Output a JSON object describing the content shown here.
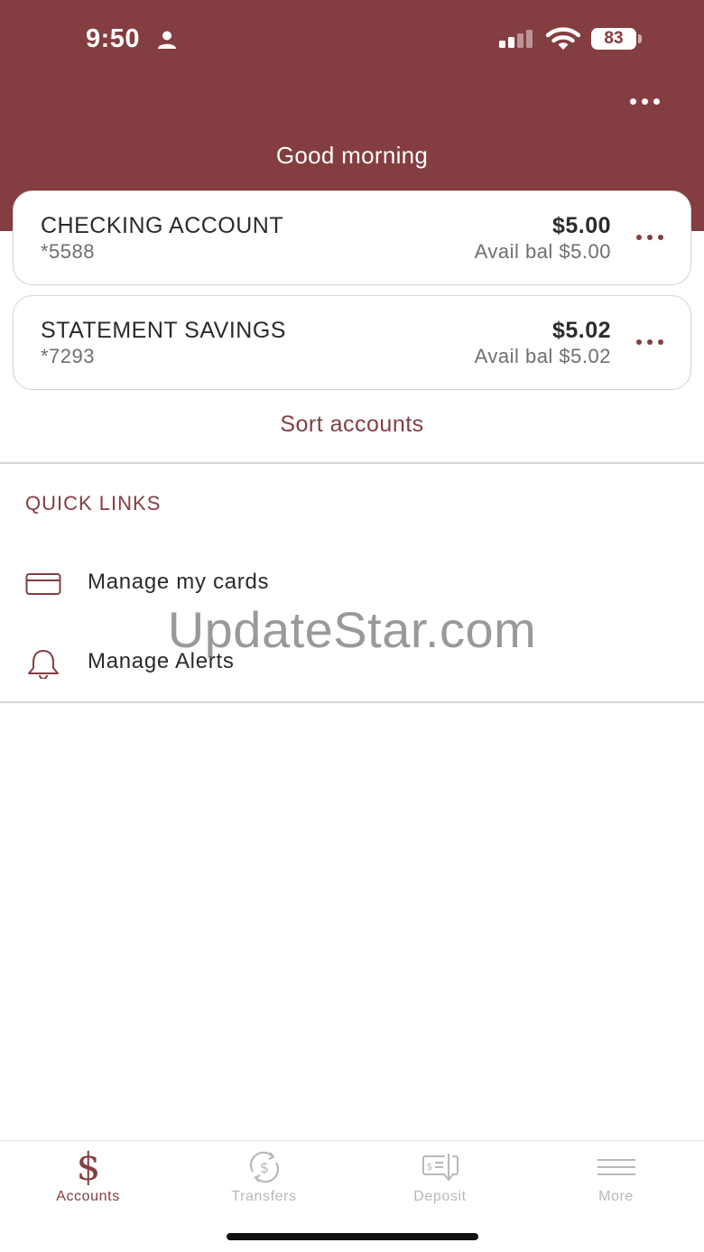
{
  "status_bar": {
    "time": "9:50",
    "battery": "83"
  },
  "header": {
    "greeting": "Good morning",
    "more_icon": "more-horizontal-icon",
    "color": "#843d40"
  },
  "accounts": [
    {
      "name": "CHECKING ACCOUNT",
      "number": "*5588",
      "balance": "$5.00",
      "available": "Avail bal $5.00"
    },
    {
      "name": "STATEMENT SAVINGS",
      "number": "*7293",
      "balance": "$5.02",
      "available": "Avail bal $5.02"
    }
  ],
  "sort_accounts": "Sort accounts",
  "quick_links": {
    "heading": "QUICK LINKS",
    "items": [
      {
        "label": "Manage my cards",
        "icon": "credit-card-icon"
      },
      {
        "label": "Manage Alerts",
        "icon": "bell-icon"
      }
    ]
  },
  "watermark": "UpdateStar.com",
  "tabs": [
    {
      "label": "Accounts",
      "icon": "dollar-icon",
      "active": true
    },
    {
      "label": "Transfers",
      "icon": "transfer-dollar-icon",
      "active": false
    },
    {
      "label": "Deposit",
      "icon": "check-deposit-icon",
      "active": false
    },
    {
      "label": "More",
      "icon": "menu-icon",
      "active": false
    }
  ],
  "colors": {
    "accent": "#843d40",
    "inactive": "#b8b8b8"
  }
}
